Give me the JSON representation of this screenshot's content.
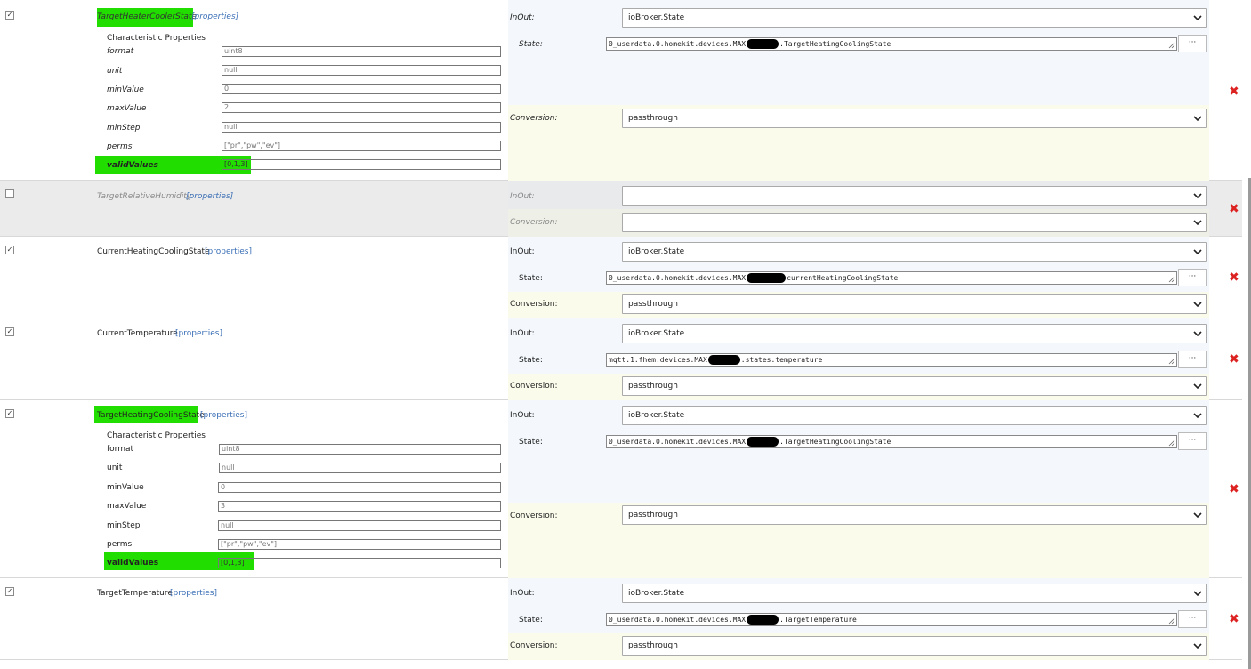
{
  "rows": [
    {
      "name": "TargetHeaterCoolerState",
      "props_link": "[properties]",
      "inout_label": "InOut:",
      "inout_value": "ioBroker.State",
      "state_label": "State:",
      "state_pre": "0_userdata.0.homekit.devices.MAX",
      "state_post": ".TargetHeatingCoolingState",
      "dots": "···",
      "conversion_label": "Conversion:",
      "conversion_value": "passthrough",
      "char_props_title": "Characteristic Properties",
      "props": [
        {
          "label": "format",
          "value": "uint8"
        },
        {
          "label": "unit",
          "value": "null"
        },
        {
          "label": "minValue",
          "value": "0"
        },
        {
          "label": "maxValue",
          "value": "2"
        },
        {
          "label": "minStep",
          "value": "null"
        },
        {
          "label": "perms",
          "value": "[\"pr\",\"pw\",\"ev\"]"
        },
        {
          "label": "validValues",
          "value": "[0,1,3]"
        }
      ]
    },
    {
      "name": "TargetRelativeHumidity",
      "props_link": "[properties]",
      "inout_label": "InOut:",
      "conversion_label": "Conversion:"
    },
    {
      "name": "CurrentHeatingCoolingState",
      "props_link": "[properties]",
      "inout_label": "InOut:",
      "inout_value": "ioBroker.State",
      "state_label": "State:",
      "state_pre": "0_userdata.0.homekit.devices.MAX",
      "state_post": "currentHeatingCoolingState",
      "dots": "···",
      "conversion_label": "Conversion:",
      "conversion_value": "passthrough"
    },
    {
      "name": "CurrentTemperature",
      "props_link": "[properties]",
      "inout_label": "InOut:",
      "inout_value": "ioBroker.State",
      "state_label": "State:",
      "state_pre": "mqtt.1.fhem.devices.MAX",
      "state_post": ".states.temperature",
      "dots": "···",
      "conversion_label": "Conversion:",
      "conversion_value": "passthrough"
    },
    {
      "name": "TargetHeatingCoolingState",
      "props_link": "[properties]",
      "inout_label": "InOut:",
      "inout_value": "ioBroker.State",
      "state_label": "State:",
      "state_pre": "0_userdata.0.homekit.devices.MAX",
      "state_post": ".TargetHeatingCoolingState",
      "dots": "···",
      "conversion_label": "Conversion:",
      "conversion_value": "passthrough",
      "char_props_title": "Characteristic Properties",
      "props": [
        {
          "label": "format",
          "value": "uint8"
        },
        {
          "label": "unit",
          "value": "null"
        },
        {
          "label": "minValue",
          "value": "0"
        },
        {
          "label": "maxValue",
          "value": "3"
        },
        {
          "label": "minStep",
          "value": "null"
        },
        {
          "label": "perms",
          "value": "[\"pr\",\"pw\",\"ev\"]"
        },
        {
          "label": "validValues",
          "value": "[0,1,3]"
        }
      ]
    },
    {
      "name": "TargetTemperature",
      "props_link": "[properties]",
      "inout_label": "InOut:",
      "inout_value": "ioBroker.State",
      "state_label": "State:",
      "state_pre": "0_userdata.0.homekit.devices.MAX",
      "state_post": ".TargetTemperature",
      "dots": "···",
      "conversion_label": "Conversion:",
      "conversion_value": "passthrough"
    }
  ],
  "icons": {
    "check": "✓",
    "delete": "✖"
  },
  "colors": {
    "highlight": "#22dd00",
    "link": "#3b6fb6",
    "delete": "#dd2222"
  }
}
